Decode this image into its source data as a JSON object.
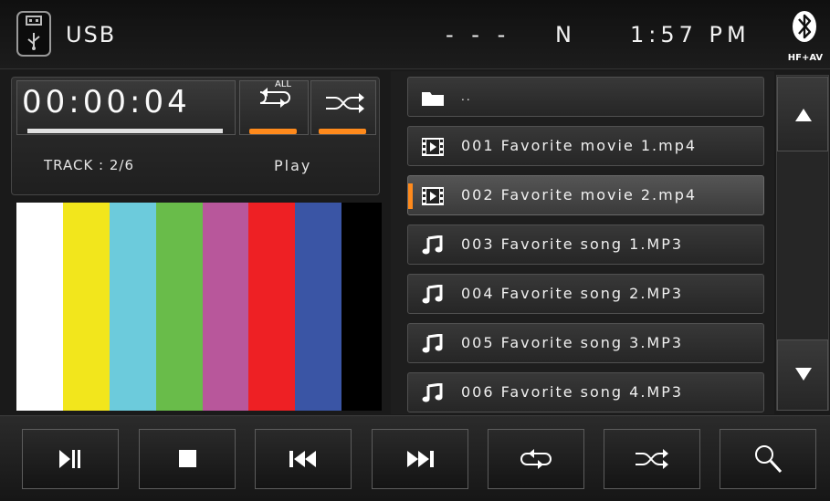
{
  "header": {
    "source": "USB",
    "status_dashes": "- - -",
    "status_n": "N",
    "clock": "1:57 PM",
    "bluetooth_label": "HF+AV"
  },
  "now_playing": {
    "elapsed": "00:00:04",
    "repeat_badge": "ALL",
    "track": "TRACK : 2/6",
    "state": "Play"
  },
  "colors": {
    "accent": "#ff8a1c",
    "color_bars": [
      "#ffffff",
      "#f2e61c",
      "#6ccbdc",
      "#69bc4a",
      "#b8579b",
      "#ee2024",
      "#3a55a5",
      "#000000"
    ]
  },
  "file_list": {
    "parent_folder_label": "..",
    "items": [
      {
        "label": "001 Favorite movie 1.mp4",
        "type": "video",
        "selected": false
      },
      {
        "label": "002 Favorite movie 2.mp4",
        "type": "video",
        "selected": true
      },
      {
        "label": "003 Favorite song 1.MP3",
        "type": "audio",
        "selected": false
      },
      {
        "label": "004 Favorite song 2.MP3",
        "type": "audio",
        "selected": false
      },
      {
        "label": "005 Favorite song 3.MP3",
        "type": "audio",
        "selected": false
      },
      {
        "label": "006 Favorite song 4.MP3",
        "type": "audio",
        "selected": false
      }
    ]
  },
  "controls": {
    "buttons": [
      "play-pause-icon",
      "stop-icon",
      "previous-track-icon",
      "next-track-icon",
      "repeat-icon",
      "shuffle-icon",
      "search-icon"
    ]
  }
}
